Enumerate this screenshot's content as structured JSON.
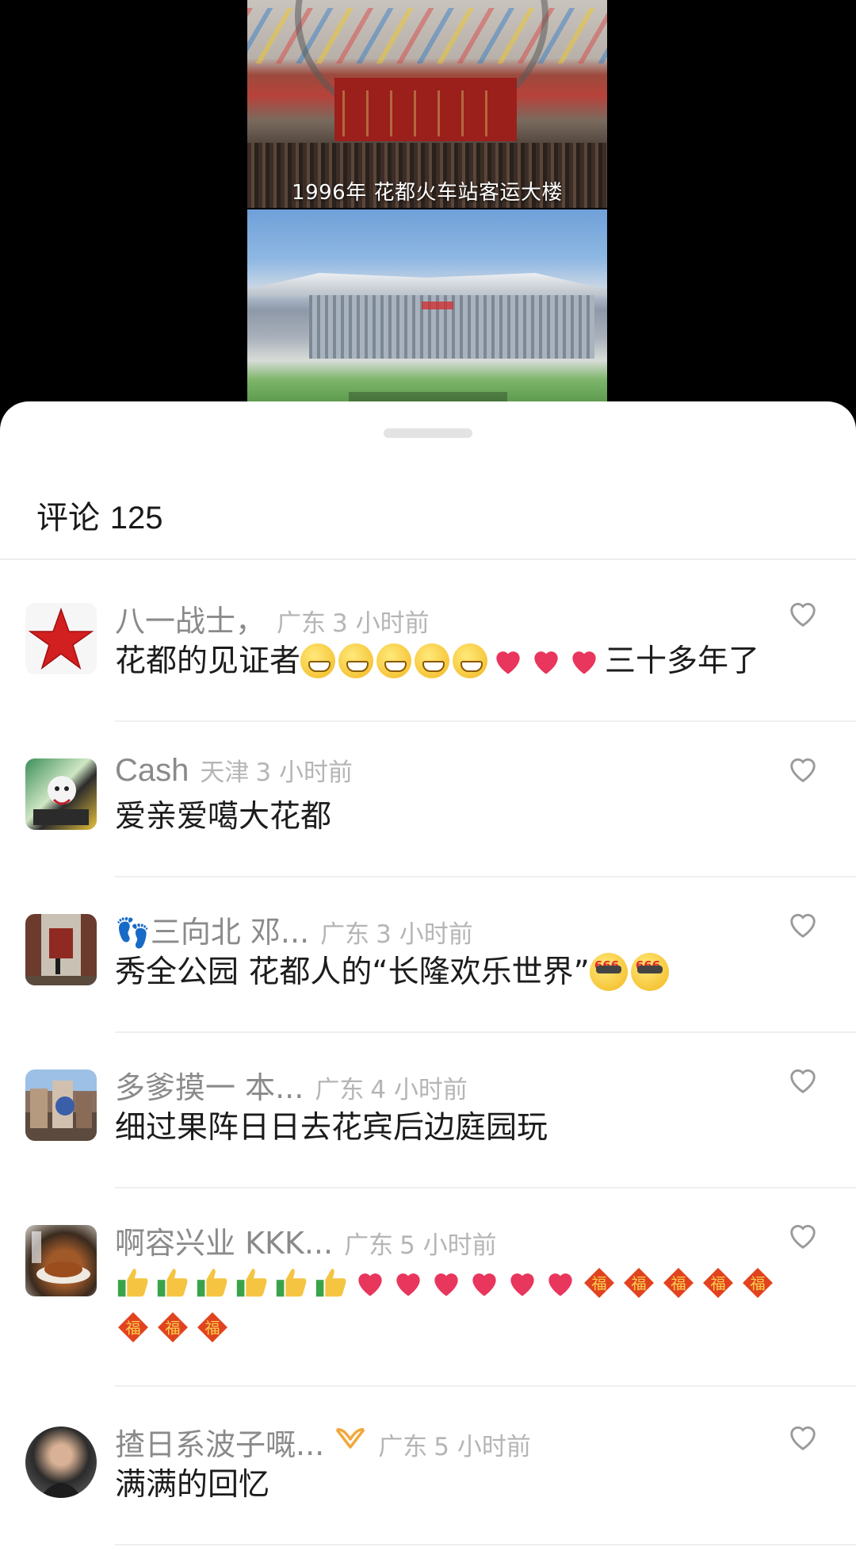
{
  "media": {
    "caption_top": "1996年 花都火车站客运大楼"
  },
  "sheet": {
    "title_prefix": "评论",
    "comment_count": "125"
  },
  "comments": [
    {
      "username": "八一战士，",
      "location": "广东",
      "time": "3 小时前",
      "text_parts": [
        "花都的见证者",
        "三十多年了"
      ],
      "emoji": [
        "grin",
        "grin",
        "grin",
        "grin",
        "grin",
        "heart",
        "heart",
        "heart"
      ],
      "avatar": "red-star-avatar"
    },
    {
      "username": "Cash",
      "location": "天津",
      "time": "3 小时前",
      "text_parts": [
        "爱亲爱噶大花都"
      ],
      "avatar": "cartoon-avatar"
    },
    {
      "username": "三向北 邓...",
      "username_prefix_icon": "footsteps-icon",
      "location": "广东",
      "time": "3 小时前",
      "text_parts": [
        "秀全公园 花都人的“长隆欢乐世界”"
      ],
      "emoji": [
        "cool-666",
        "cool-666"
      ],
      "avatar": "museum-avatar"
    },
    {
      "username": "多爹摸一 本...",
      "location": "广东",
      "time": "4 小时前",
      "text_parts": [
        "细过果阵日日去花宾后边庭园玩"
      ],
      "avatar": "street-avatar"
    },
    {
      "username": "啊容兴业 KKK...",
      "location": "广东",
      "time": "5 小时前",
      "text_parts": [],
      "emoji": [
        "thumb",
        "thumb",
        "thumb",
        "thumb",
        "thumb",
        "thumb",
        "heart",
        "heart",
        "heart",
        "heart",
        "heart",
        "heart",
        "fu",
        "fu",
        "fu",
        "fu",
        "fu",
        "fu",
        "fu",
        "fu"
      ],
      "avatar": "food-avatar"
    },
    {
      "username": "揸日系波子嘅...",
      "vip_badge": "vip-badge-icon",
      "location": "广东",
      "time": "5 小时前",
      "text_parts": [
        "满满的回忆"
      ],
      "avatar": "portrait-avatar"
    }
  ],
  "colors": {
    "username": "#8a8a8a",
    "meta": "#b5b5b5",
    "text": "#1c1c1c",
    "heart_emoji": "#e8365c",
    "vip": "#f2a83b"
  }
}
